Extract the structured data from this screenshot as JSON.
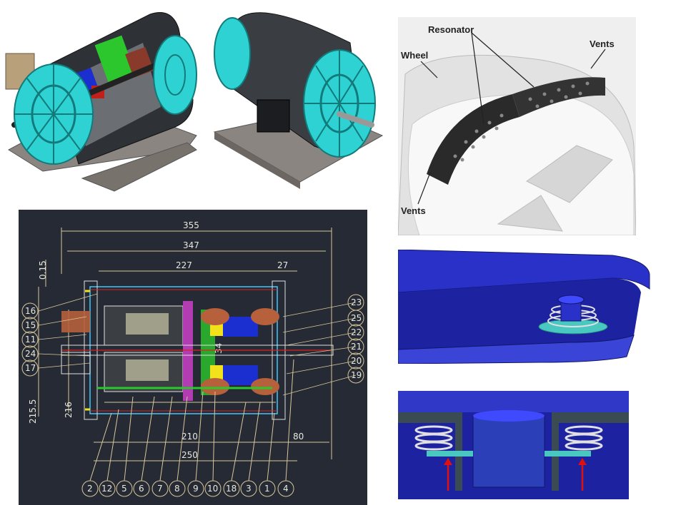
{
  "colors": {
    "cad_background": "#252a34",
    "motor_cyan": "#2fd2d2",
    "motor_body": "#3a3d42",
    "mount_gray": "#8a8580",
    "stator_blue": "#1b2fd0",
    "stator_green": "#2cc72c",
    "stator_yellow": "#f2e21b",
    "cad_line": "#d8c79a",
    "cad_accent_magenta": "#c23bc2",
    "rim_blue": "#2a31c8",
    "spring_teal": "#48c8c0",
    "arrow_red": "#e01010"
  },
  "cad": {
    "dimensions": {
      "d355": "355",
      "d347": "347",
      "d227": "227",
      "d27": "27",
      "d015": "0.15",
      "d34": "34",
      "d216": "216",
      "d2155": "215.5",
      "d210": "210",
      "d250": "250",
      "d80": "80"
    },
    "callouts_left": [
      "16",
      "15",
      "11",
      "24",
      "17"
    ],
    "callouts_right": [
      "23",
      "25",
      "22",
      "21",
      "20",
      "19"
    ],
    "callouts_bottom": [
      "2",
      "12",
      "5",
      "6",
      "7",
      "8",
      "9",
      "10",
      "18",
      "3",
      "1",
      "4"
    ]
  },
  "wheel": {
    "label_resonator": "Resonator",
    "label_wheel": "Wheel",
    "label_vents_top": "Vents",
    "label_vents_bottom": "Vents"
  }
}
